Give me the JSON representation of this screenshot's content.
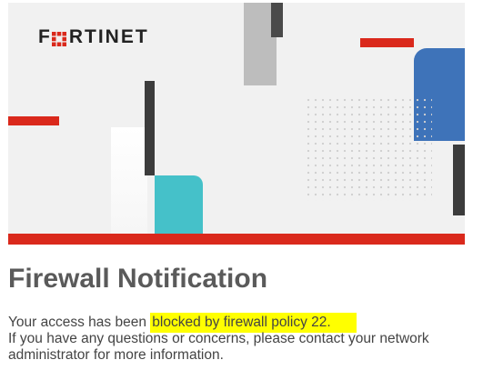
{
  "brand": {
    "logo_text": "FORTINET",
    "logo_mark": "fortinet-grid-logo"
  },
  "colors": {
    "accent_red": "#da291c",
    "accent_blue": "#3e73b9",
    "accent_teal": "#45c1c9",
    "banner_gray": "#f1f1f1",
    "title_gray": "#5a5a5a",
    "highlight": "#ffff00"
  },
  "notification": {
    "title": "Firewall Notification",
    "line1_prefix": "Your access has been",
    "line1_highlight": "blocked by firewall policy 22.",
    "line2": "If you have any questions or concerns, please contact your network",
    "line3": "administrator for more information."
  }
}
